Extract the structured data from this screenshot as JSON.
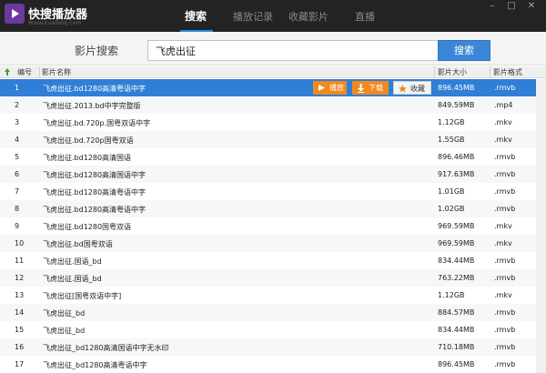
{
  "app": {
    "title": "快搜播放器",
    "subtitle": "Www.kuaiboq.com"
  },
  "nav": {
    "items": [
      {
        "label": "搜索",
        "active": true
      },
      {
        "label": "播放记录",
        "active": false
      },
      {
        "label": "收藏影片",
        "active": false
      },
      {
        "label": "直播",
        "active": false
      }
    ]
  },
  "window_controls": {
    "minimize": "–",
    "maximize": "□",
    "close": "✕"
  },
  "search": {
    "label": "影片搜索",
    "value": "飞虎出征",
    "button": "搜索"
  },
  "table": {
    "headers": {
      "num": "编号",
      "name": "影片名称",
      "size": "影片大小",
      "format": "影片格式"
    },
    "actions": {
      "play": "播放",
      "download": "下载",
      "favorite": "收藏"
    },
    "rows": [
      {
        "num": "1",
        "name": "飞虎出征.bd1280高清粤语中字",
        "size": "896.45MB",
        "format": ".rmvb",
        "selected": true
      },
      {
        "num": "2",
        "name": "飞虎出征.2013.bd中字完整版",
        "size": "849.59MB",
        "format": ".mp4"
      },
      {
        "num": "3",
        "name": "飞虎出征.bd.720p.国粤双语中字",
        "size": "1.12GB",
        "format": ".mkv"
      },
      {
        "num": "4",
        "name": "飞虎出征.bd.720p国粤双语",
        "size": "1.55GB",
        "format": ".mkv"
      },
      {
        "num": "5",
        "name": "飞虎出征.bd1280高清国语",
        "size": "896.46MB",
        "format": ".rmvb"
      },
      {
        "num": "6",
        "name": "飞虎出征.bd1280高清国语中字",
        "size": "917.63MB",
        "format": ".rmvb"
      },
      {
        "num": "7",
        "name": "飞虎出征.bd1280高清粤语中字",
        "size": "1.01GB",
        "format": ".rmvb"
      },
      {
        "num": "8",
        "name": "飞虎出征.bd1280高清粤语中字",
        "size": "1.02GB",
        "format": ".rmvb"
      },
      {
        "num": "9",
        "name": "飞虎出征.bd1280国粤双语",
        "size": "969.59MB",
        "format": ".mkv"
      },
      {
        "num": "10",
        "name": "飞虎出征.bd国粤双语",
        "size": "969.59MB",
        "format": ".mkv"
      },
      {
        "num": "11",
        "name": "飞虎出征.国语_bd",
        "size": "834.44MB",
        "format": ".rmvb"
      },
      {
        "num": "12",
        "name": "飞虎出征.国语_bd",
        "size": "763.22MB",
        "format": ".rmvb"
      },
      {
        "num": "13",
        "name": "飞虎出征[国粤双语中字]",
        "size": "1.12GB",
        "format": ".mkv"
      },
      {
        "num": "14",
        "name": "飞虎出征_bd",
        "size": "884.57MB",
        "format": ".rmvb"
      },
      {
        "num": "15",
        "name": "飞虎出征_bd",
        "size": "834.44MB",
        "format": ".rmvb"
      },
      {
        "num": "16",
        "name": "飞虎出征_bd1280高清国语中字无水印",
        "size": "710.18MB",
        "format": ".rmvb"
      },
      {
        "num": "17",
        "name": "飞虎出征_bd1280高清粤语中字",
        "size": "896.45MB",
        "format": ".rmvb"
      }
    ]
  },
  "colors": {
    "titlebar": "#232323",
    "accent": "#2f7fd6",
    "action_orange": "#f08a1e"
  }
}
